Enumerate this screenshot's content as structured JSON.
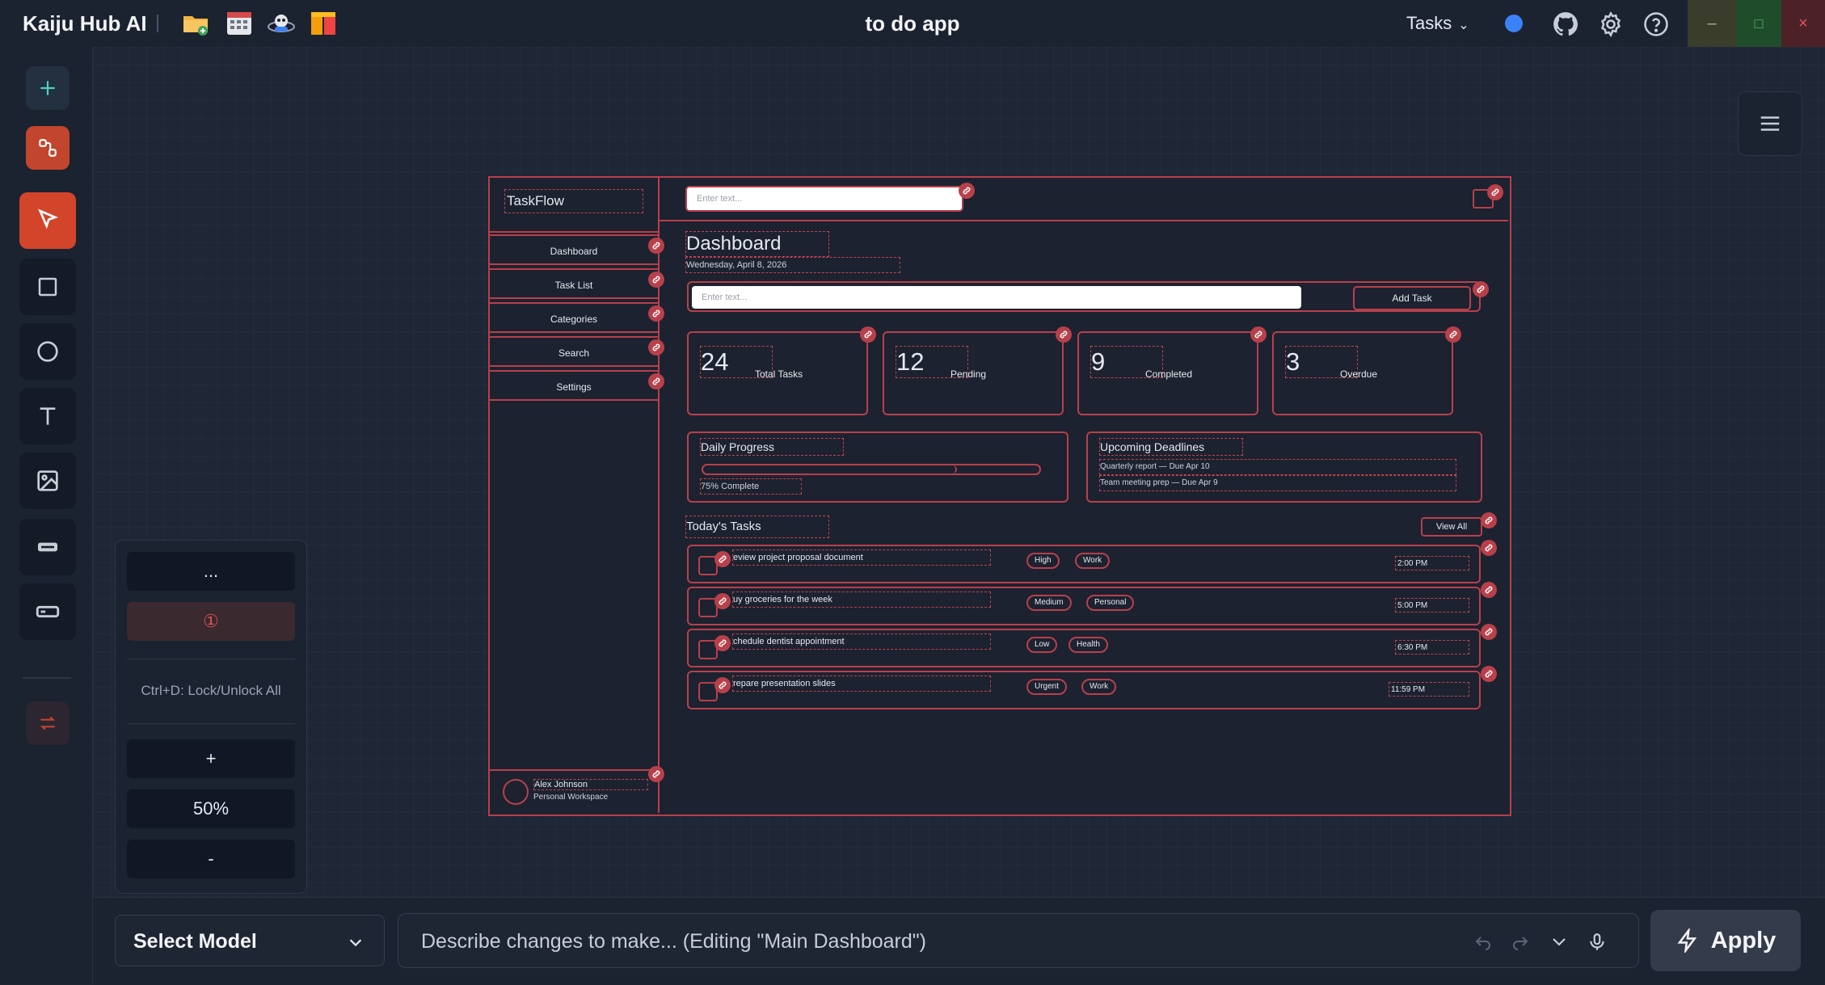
{
  "titlebar": {
    "app_name": "Kaiju Hub AI",
    "window_title": "to do app",
    "tasks_menu": "Tasks",
    "icons": [
      "folder-icon",
      "calendar-icon",
      "robot-icon",
      "gift-icon",
      "github-icon",
      "gear-icon",
      "help-icon"
    ],
    "window_buttons": {
      "minimize": "–",
      "maximize": "□",
      "close": "×"
    }
  },
  "colors": {
    "accent": "#b8404a",
    "active_tool": "#d2452b",
    "background": "#1e2533",
    "status_dot": "#3b82f6"
  },
  "left_toolbar": {
    "tools": [
      "add-icon",
      "connect-icon",
      "select-pointer-icon",
      "rectangle-icon",
      "circle-icon",
      "text-icon",
      "image-icon",
      "button-icon",
      "input-icon",
      "swap-icon"
    ]
  },
  "zoom_panel": {
    "more": "...",
    "warning": "①",
    "hint": "Ctrl+D: Lock/Unlock All",
    "zoom_in": "+",
    "zoom_level": "50%",
    "zoom_out": "-"
  },
  "design": {
    "brand": "TaskFlow",
    "nav": [
      "Dashboard",
      "Task List",
      "Categories",
      "Search",
      "Settings"
    ],
    "user": {
      "name": "Alex Johnson",
      "workspace": "Personal Workspace"
    },
    "top_search_placeholder": "Enter text...",
    "page_title": "Dashboard",
    "page_date": "Wednesday, April 8, 2026",
    "task_input_placeholder": "Enter text...",
    "add_task": "Add Task",
    "stats": [
      {
        "value": "24",
        "label": "Total Tasks"
      },
      {
        "value": "12",
        "label": "Pending"
      },
      {
        "value": "9",
        "label": "Completed"
      },
      {
        "value": "3",
        "label": "Overdue"
      }
    ],
    "daily_progress": {
      "title": "Daily Progress",
      "text": "75% Complete",
      "fraction": 0.75
    },
    "upcoming": {
      "title": "Upcoming Deadlines",
      "items": [
        "Quarterly report — Due Apr 10",
        "Team meeting prep — Due Apr 9"
      ]
    },
    "todays_tasks_title": "Today's Tasks",
    "view_all": "View All",
    "tasks": [
      {
        "text": "eview project proposal document",
        "priority": "High",
        "category": "Work",
        "time": "2:00 PM"
      },
      {
        "text": "uy groceries for the week",
        "priority": "Medium",
        "category": "Personal",
        "time": "5:00 PM"
      },
      {
        "text": "chedule dentist appointment",
        "priority": "Low",
        "category": "Health",
        "time": "6:30 PM"
      },
      {
        "text": "repare presentation slides",
        "priority": "Urgent",
        "category": "Work",
        "time": "11:59 PM"
      }
    ]
  },
  "bottom": {
    "model_select": "Select Model",
    "prompt_placeholder": "Describe changes to make... (Editing \"Main Dashboard\")",
    "apply": "Apply"
  }
}
